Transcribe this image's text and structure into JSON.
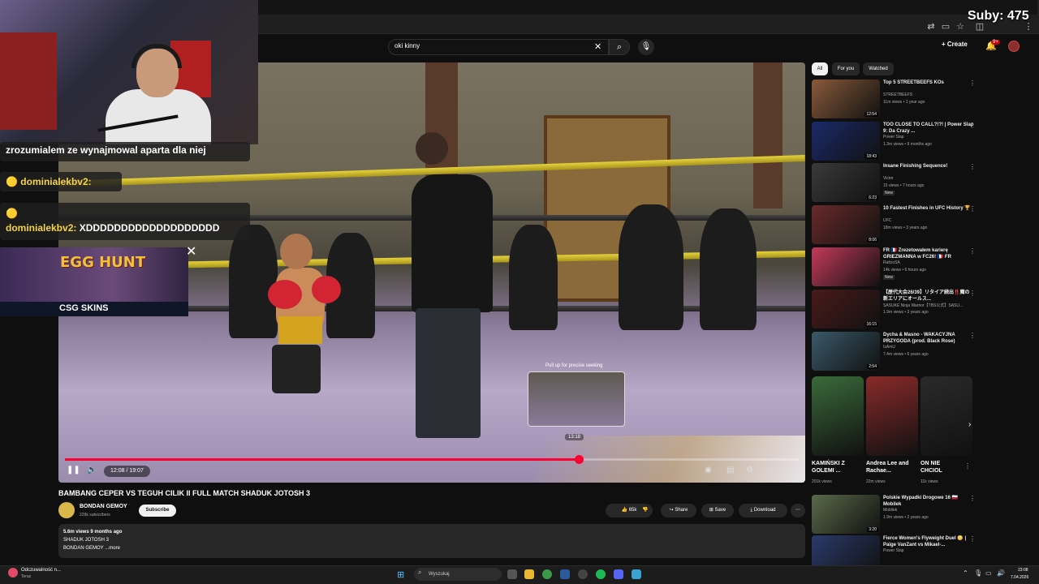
{
  "search": {
    "query": "oki kinny"
  },
  "header": {
    "create_label": "Create",
    "notif_badge": "9+"
  },
  "player": {
    "seek_hint": "Pull up for precise seeking",
    "seek_time": "13:18",
    "time_display": "12:08 / 19:07",
    "progress_fraction": 0.7
  },
  "video": {
    "title": "BAMBANG CEPER VS TEGUH CILIK II FULL MATCH SHADUK JOTOSH 3",
    "channel": "BONDAN GEMOY",
    "subscribers": "229k subscribers",
    "subscribe_label": "Subscribe",
    "likes": "65k",
    "share_label": "Share",
    "save_label": "Save",
    "download_label": "Download",
    "views_line": "5.6m views  9 months ago",
    "desc_line1": "SHADUK JOTOSH 3",
    "desc_line2": "BONDAN GEMOY ...more"
  },
  "filters": [
    "All",
    "For you",
    "Watched"
  ],
  "recommendations": [
    {
      "title": "Top 5 STREETBEEFS KOs",
      "channel": "STREETBEEFS",
      "meta": "11m views • 1 year ago",
      "duration": "12:54",
      "color": "#8a5a3a"
    },
    {
      "title": "TOO CLOSE TO CALL?!?! | Power Slap 9: Da Crazy ...",
      "channel": "Power Slap",
      "meta": "1.3m views • 9 months ago",
      "duration": "18:43",
      "color": "#1a2a6a"
    },
    {
      "title": "Insane Finishing Sequence!",
      "channel": "Victor",
      "meta": "15 views • 7 hours ago",
      "badge": "New",
      "duration": "6:23",
      "color": "#3a3a3a"
    },
    {
      "title": "10 Fastest Finishes in UFC History 🏆",
      "channel": "UFC",
      "meta": "18m views • 3 years ago",
      "duration": "8:06",
      "color": "#6a2a2a"
    },
    {
      "title": "FR 🇫🇷 Zrezetowałem karierę GRIEZMANNA w FC26! 🇫🇷 FR",
      "channel": "RafcioSA",
      "meta": "14k views • 6 hours ago",
      "badge": "New",
      "duration": "",
      "color": "#c43a5a"
    },
    {
      "title": "【歴代大会26/39】リタイア続出‼️魔の新エリアにオールス...",
      "channel": "SASUKE Ninja Warrior【TBS公式】SASU...",
      "meta": "1.9m views • 3 years ago",
      "duration": "16:15",
      "color": "#4a1a1a"
    },
    {
      "title": "Dycha & Masno - WAKACYJNA PRZYGODA (prod. Black Rose)",
      "channel": "IsAmU",
      "meta": "7.4m views • 6 years ago",
      "duration": "2:54",
      "color": "#3a5a6a"
    }
  ],
  "shorts": [
    {
      "title": "KAMIŃSKI Z GOLEMI ...",
      "views": "201k views",
      "color": "#3a6a3a"
    },
    {
      "title": "Andrea Lee and Rachae...",
      "views": "22m views",
      "color": "#8a2a2a"
    },
    {
      "title": "ON NIE CHCIOL",
      "views": "11k views",
      "color": "#2a2a2a"
    }
  ],
  "more_recs": [
    {
      "title": "Polskie Wypadki Drogowe  16 🇵🇱 Mobilek",
      "channel": "Mobilek",
      "meta": "1.9m views • 2 years ago",
      "duration": "3:20",
      "color": "#5a6a4a"
    },
    {
      "title": "Fierce Women's Flyweight Duel 😳 | Paige VanZant vs Mikael-...",
      "channel": "Power Slap",
      "meta": "",
      "duration": "",
      "color": "#2a3a6a"
    }
  ],
  "overlay": {
    "chat_msg1": "zrozumialem ze wynajmowal aparta dla niej",
    "chat_user2": "dominialekbv2:",
    "chat_msg2": "",
    "chat_user3": "dominialekbv2:",
    "chat_msg3": "XDDDDDDDDDDDDDDDDDDD",
    "egg_title": "EGG HUNT",
    "csg_label": "CSG SKINS",
    "subs_counter": "Suby: 475"
  },
  "taskbar": {
    "notif_title": "Odczuwalność n...",
    "notif_sub": "Teraz",
    "search_placeholder": "Wyszukaj",
    "time": "23:08",
    "date": "7.04.2026"
  }
}
